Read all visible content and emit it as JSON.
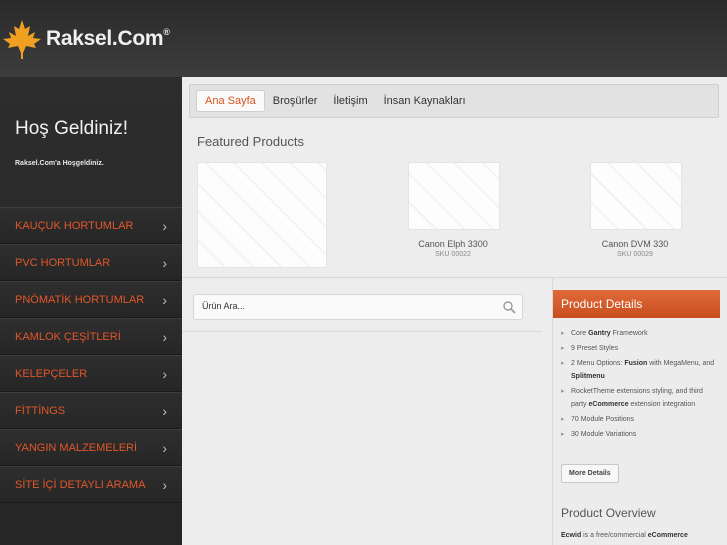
{
  "brand": {
    "name": "Raksel.Com",
    "reg": "®",
    "leaf_color": "#f0a020"
  },
  "sidebar": {
    "welcome_title": "Hoş Geldiniz!",
    "welcome_sub": "Raksel.Com'a Hoşgeldiniz.",
    "items": [
      {
        "label": "KAUÇUK HORTUMLAR"
      },
      {
        "label": "PVC HORTUMLAR"
      },
      {
        "label": "PNÖMATİK HORTUMLAR"
      },
      {
        "label": "KAMLOK ÇEŞİTLERİ"
      },
      {
        "label": "KELEPÇELER"
      },
      {
        "label": "FİTTİNGS"
      },
      {
        "label": "YANGIN MALZEMELERİ"
      },
      {
        "label": "SİTE İÇİ DETAYLI ARAMA"
      }
    ],
    "chevron": "›"
  },
  "nav": {
    "tabs": [
      {
        "label": "Ana Sayfa"
      },
      {
        "label": "Broşürler"
      },
      {
        "label": "İletişim"
      },
      {
        "label": "İnsan Kaynakları"
      }
    ]
  },
  "featured": {
    "title": "Featured Products",
    "products": [
      {
        "name": "Canon Elph 3300",
        "sku": "SKU 00022"
      },
      {
        "name": "Canon DVM 330",
        "sku": "SKU 00029"
      }
    ]
  },
  "search": {
    "value": "Ürün Ara..."
  },
  "product_details": {
    "title": "Product Details",
    "features": [
      {
        "pre": "Core ",
        "bold": "Gantry",
        "post": " Framework"
      },
      {
        "pre": "9 Preset Styles",
        "bold": "",
        "post": ""
      },
      {
        "pre": "2 Menu Options: ",
        "bold": "Fusion",
        "post": " with MegaMenu, and ",
        "bold2": "Splitmenu"
      },
      {
        "pre": "RocketTheme extensions styling, and third party ",
        "bold": "eCommerce",
        "post": " extension integration"
      },
      {
        "pre": "70 Module Positions",
        "bold": "",
        "post": ""
      },
      {
        "pre": "30 Module Variations",
        "bold": "",
        "post": ""
      }
    ],
    "more_button": "More Details"
  },
  "product_overview": {
    "title": "Product Overview",
    "text_bold": "Ecwid",
    "text_mid": " is a free/commercial ",
    "text_bold2": "eCommerce"
  },
  "colors": {
    "accent": "#d9531e",
    "menu_text": "#e2572a",
    "header_bg": "#2a2a2a"
  }
}
